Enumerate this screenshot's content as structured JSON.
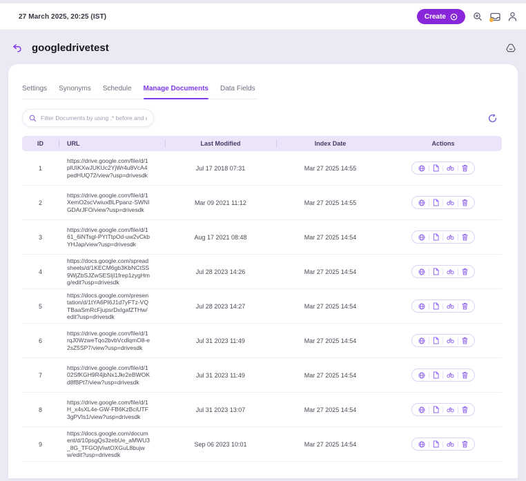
{
  "topbar": {
    "datetime": "27 March 2025, 20:25 (IST)",
    "create_label": "Create"
  },
  "header": {
    "title": "googledrivetest"
  },
  "tabs": [
    {
      "label": "Settings",
      "active": false
    },
    {
      "label": "Synonyms",
      "active": false
    },
    {
      "label": "Schedule",
      "active": false
    },
    {
      "label": "Manage Documents",
      "active": true
    },
    {
      "label": "Data Fields",
      "active": false
    }
  ],
  "filter": {
    "placeholder": "Filter Documents by using .* before and after the"
  },
  "table": {
    "columns": [
      "ID",
      "URL",
      "Last Modified",
      "Index Date",
      "Actions"
    ],
    "rows": [
      {
        "id": "1",
        "url": "https://drive.google.com/file/d/1plUIKXwJUKUc2YjWr4u8VcA4pedHUQ72/view?usp=drivesdk",
        "last_modified": "Jul 17 2018 07:31",
        "index_date": "Mar 27 2025 14:55"
      },
      {
        "id": "2",
        "url": "https://drive.google.com/file/d/1XemO2scVwiuxBLPpanz-SWNIGDArJFO/view?usp=drivesdk",
        "last_modified": "Mar 09 2021 11:12",
        "index_date": "Mar 27 2025 14:55"
      },
      {
        "id": "3",
        "url": "https://drive.google.com/file/d/161_6iNTsgl-PYtTtpOd-uw2vCkbYHJap/view?usp=drivesdk",
        "last_modified": "Aug 17 2021 08:48",
        "index_date": "Mar 27 2025 14:54"
      },
      {
        "id": "4",
        "url": "https://docs.google.com/spreadsheets/d/1KECM6gb3KbNCtSS9WjZbSJZwSESIjI1frep1zygHmg/edit?usp=drivesdk",
        "last_modified": "Jul 28 2023 14:26",
        "index_date": "Mar 27 2025 14:54"
      },
      {
        "id": "5",
        "url": "https://docs.google.com/presentation/d/1tYA6PI6J1d7yFTz-VQTBaaSmRcFjupsrDxIgafZTHw/edit?usp=drivesdk",
        "last_modified": "Jul 28 2023 14:27",
        "index_date": "Mar 27 2025 14:54"
      },
      {
        "id": "6",
        "url": "https://drive.google.com/file/d/1rqJ0WzweTqo2bvbVcdlqmO8-e2sZ5SP7/view?usp=drivesdk",
        "last_modified": "Jul 31 2023 11:49",
        "index_date": "Mar 27 2025 14:54"
      },
      {
        "id": "7",
        "url": "https://drive.google.com/file/d/102SfKGH9R4jbNx1Jkr2eBWOKd8fBPt7/view?usp=drivesdk",
        "last_modified": "Jul 31 2023 11:49",
        "index_date": "Mar 27 2025 14:54"
      },
      {
        "id": "8",
        "url": "https://drive.google.com/file/d/1H_x4sXL4e-GW-FB6KzBciUTF3gPVIs1/view?usp=drivesdk",
        "last_modified": "Jul 31 2023 13:07",
        "index_date": "Mar 27 2025 14:54"
      },
      {
        "id": "9",
        "url": "https://docs.google.com/document/d/10psgQs3zebUe_aMWU3_8G_TFGOjViwtOXGuL8bujww/edit?usp=drivesdk",
        "last_modified": "Sep 06 2023 10:01",
        "index_date": "Mar 27 2025 14:54"
      }
    ]
  },
  "icons": {
    "create_button": "circled-dot-icon",
    "topbar": [
      "search-icon",
      "inbox-icon",
      "user-icon"
    ],
    "notification_dot": "yellow-dot",
    "page_head": [
      "back-icon",
      "google-drive-icon"
    ],
    "filter_input": "search-icon",
    "toolbar_right": "refresh-icon",
    "row_actions": [
      "globe-icon",
      "file-icon",
      "binoculars-icon",
      "trash-icon"
    ]
  },
  "colors": {
    "accent": "#7c3aed",
    "create_button_bg": "#8826da",
    "page_bg": "#ece8f4",
    "card_bg": "#ffffff",
    "table_header_bg": "#ece5f9",
    "table_header_text": "#453a69",
    "action_icon": "#8f63f2",
    "notification_dot": "#f2b33d"
  }
}
